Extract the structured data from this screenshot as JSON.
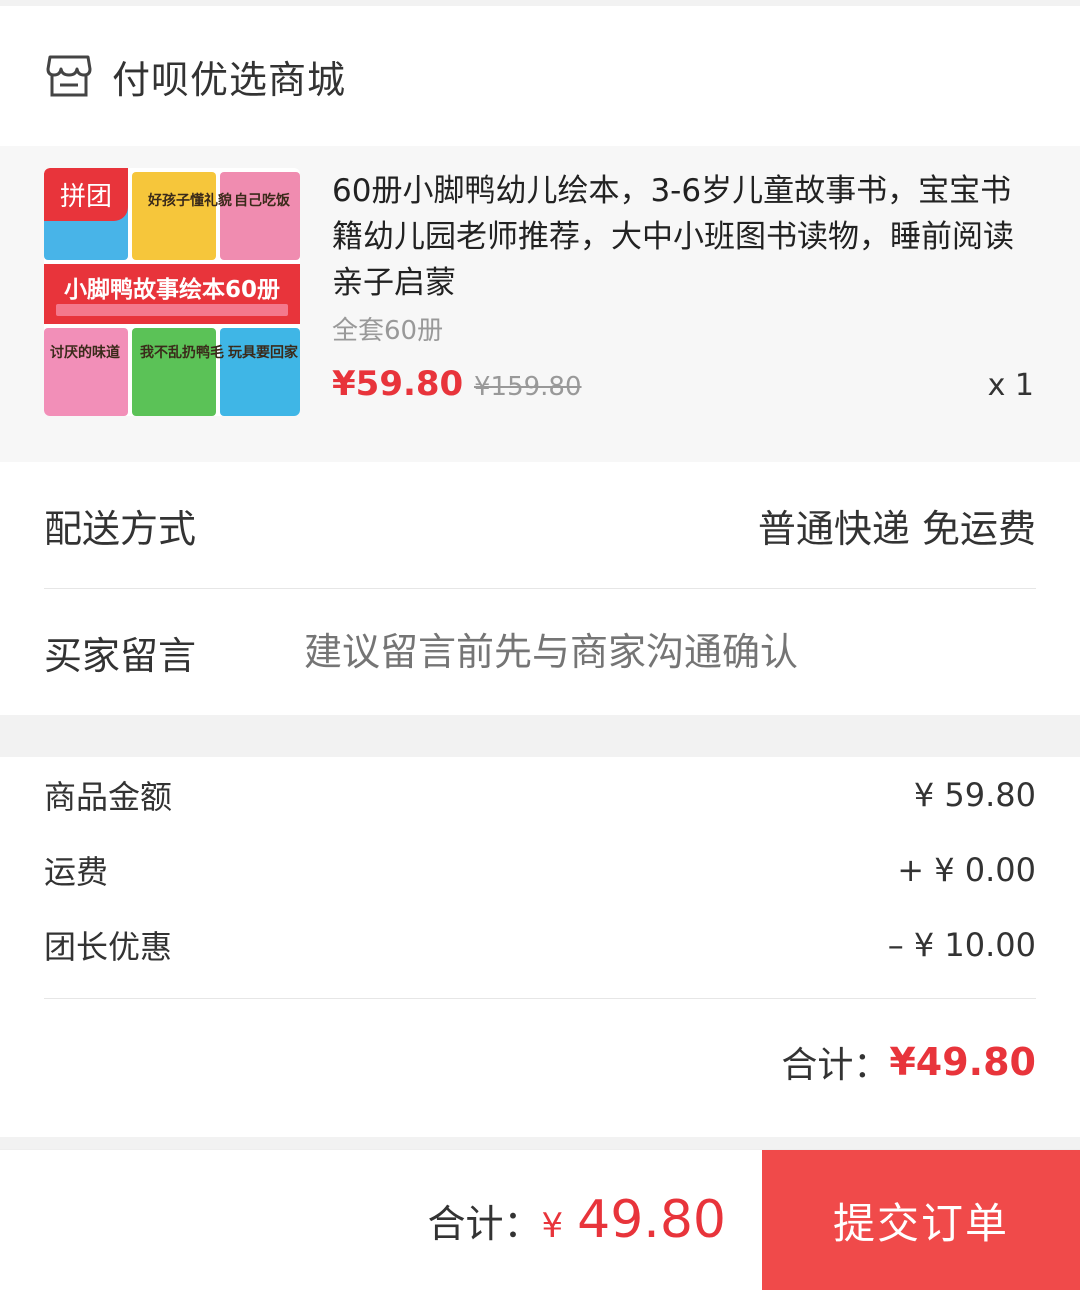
{
  "shop": {
    "name": "付呗优选商城",
    "icon": "store-icon"
  },
  "product": {
    "badge": "拼团",
    "cover": {
      "banner": "小脚鸭故事绘本60册",
      "books_top": [
        "好孩子懂礼貌",
        "自己吃饭"
      ],
      "books_bottom": [
        "讨厌的味道",
        "我不乱扔鸭毛",
        "玩具要回家"
      ]
    },
    "title": "60册小脚鸭幼儿绘本，3-6岁儿童故事书，宝宝书籍幼儿园老师推荐，大中小班图书读物，睡前阅读亲子启蒙",
    "spec": "全套60册",
    "price": "¥59.80",
    "original_price": "¥159.80",
    "quantity": "x 1"
  },
  "delivery": {
    "label": "配送方式",
    "value": "普通快递 免运费"
  },
  "message": {
    "label": "买家留言",
    "placeholder": "建议留言前先与商家沟通确认"
  },
  "summary": {
    "items": [
      {
        "label": "商品金额",
        "value": "¥ 59.80"
      },
      {
        "label": "运费",
        "value": "+ ¥ 0.00"
      },
      {
        "label": "团长优惠",
        "value": "– ¥ 10.00"
      }
    ],
    "total_label": "合计：",
    "total_value": "¥49.80"
  },
  "bottom_bar": {
    "total_label": "合计：",
    "currency": "¥",
    "total_value": "49.80",
    "submit_label": "提交订单"
  },
  "colors": {
    "accent": "#e8343b",
    "button": "#f04a4a"
  }
}
